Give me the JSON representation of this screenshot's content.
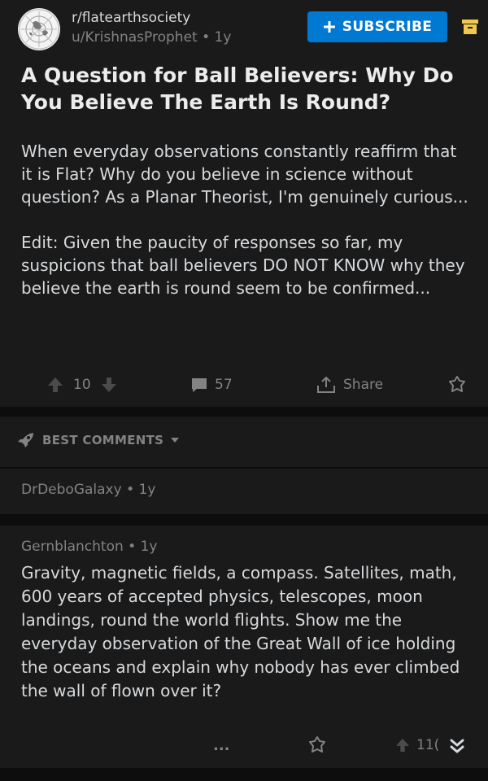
{
  "post": {
    "subreddit": "r/flatearthsociety",
    "author": "u/KrishnasProphet",
    "age": "1y",
    "subscribe_label": "SUBSCRIBE",
    "title": "A Question for Ball Believers: Why Do You Believe The Earth Is Round?",
    "body": [
      "When everyday observations constantly reaffirm that it is Flat? Why do you believe in science without question? As a Planar Theorist, I'm genuinely curious...",
      "Edit: Given the paucity of responses so far, my suspicions that ball believers DO NOT KNOW why they believe the earth is round seem to be confirmed..."
    ],
    "votes": "10",
    "comments": "57",
    "share_label": "Share"
  },
  "sort": {
    "label": "BEST COMMENTS"
  },
  "comments": [
    {
      "author": "DrDeboGalaxy",
      "age": "1y",
      "body": ""
    },
    {
      "author": "Gernblanchton",
      "age": "1y",
      "body": "Gravity, magnetic fields, a compass. Satellites, math, 600 years of accepted physics, telescopes, moon landings, round the world flights. Show me the everyday observation of the Great Wall of ice holding the oceans and explain why nobody has ever climbed the wall of flown over it?",
      "more_label": "...",
      "votes": "11("
    }
  ],
  "icons": {
    "subreddit": "flat-earth-map-icon",
    "subscribe": "plus-icon",
    "archive": "archive-icon",
    "upvote": "upvote-arrow-icon",
    "downvote": "downvote-arrow-icon",
    "comment": "comment-bubble-icon",
    "share": "share-icon",
    "award": "award-icon",
    "sort": "rocket-icon",
    "collapse": "double-chevron-down-icon"
  },
  "colors": {
    "background": "#1a1a1b",
    "accent": "#0079d3",
    "archive": "#f2c94c",
    "muted": "#818384"
  }
}
